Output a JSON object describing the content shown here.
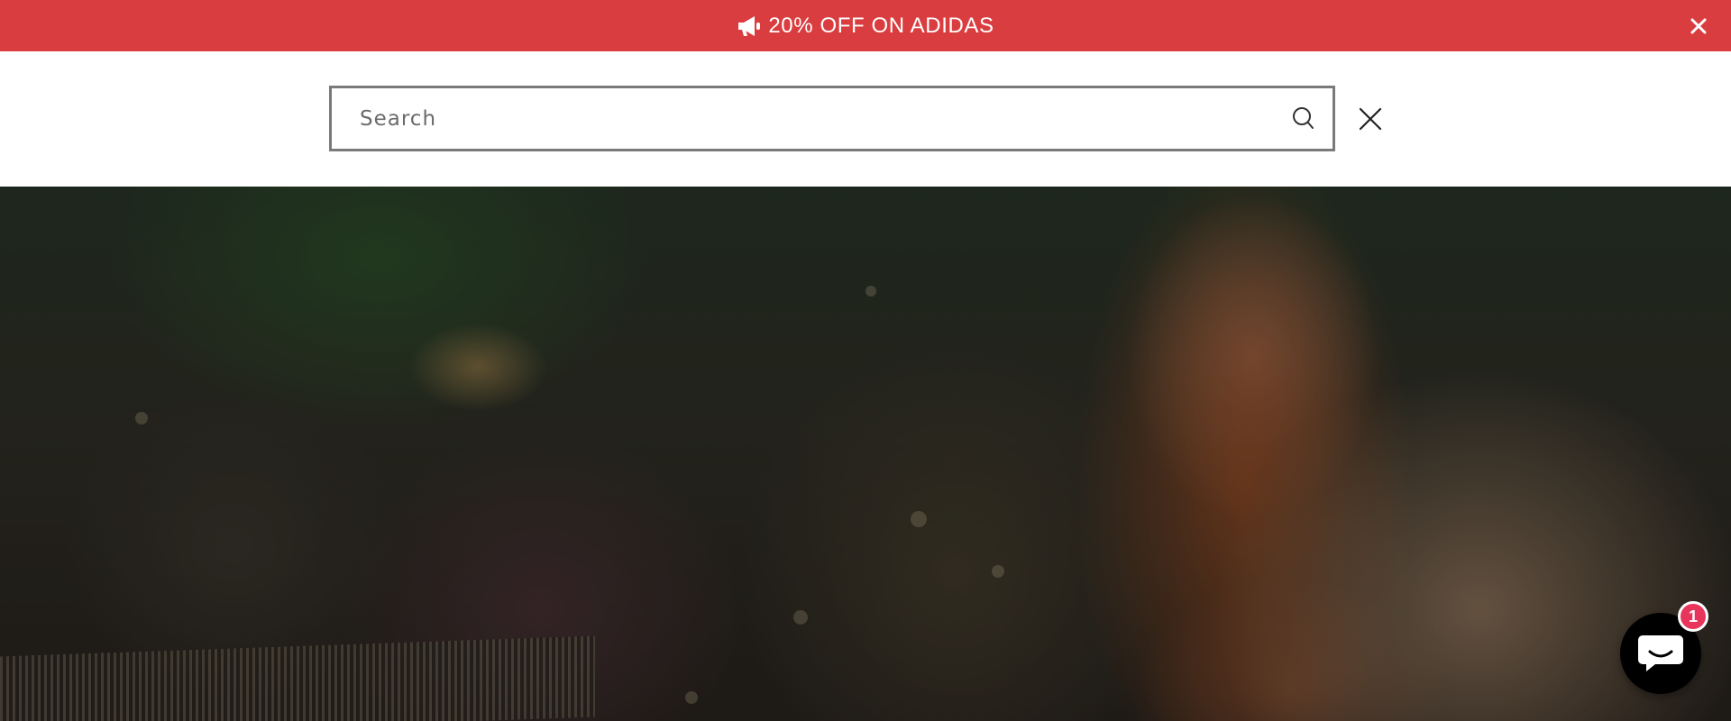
{
  "announcement": {
    "text": "20% OFF ON ADIDAS",
    "icon": "megaphone-icon",
    "close_icon": "close-icon",
    "background_color": "#da3d3f",
    "text_color": "#ffffff"
  },
  "search": {
    "placeholder": "Search",
    "value": "",
    "search_icon": "search-icon",
    "close_icon": "close-icon",
    "border_color": "#7a7a7a"
  },
  "hero": {
    "image_description_icon": "hero-photo"
  },
  "chat": {
    "icon": "chat-bubble-icon",
    "badge_count": "1",
    "badge_color": "#e8355b"
  }
}
